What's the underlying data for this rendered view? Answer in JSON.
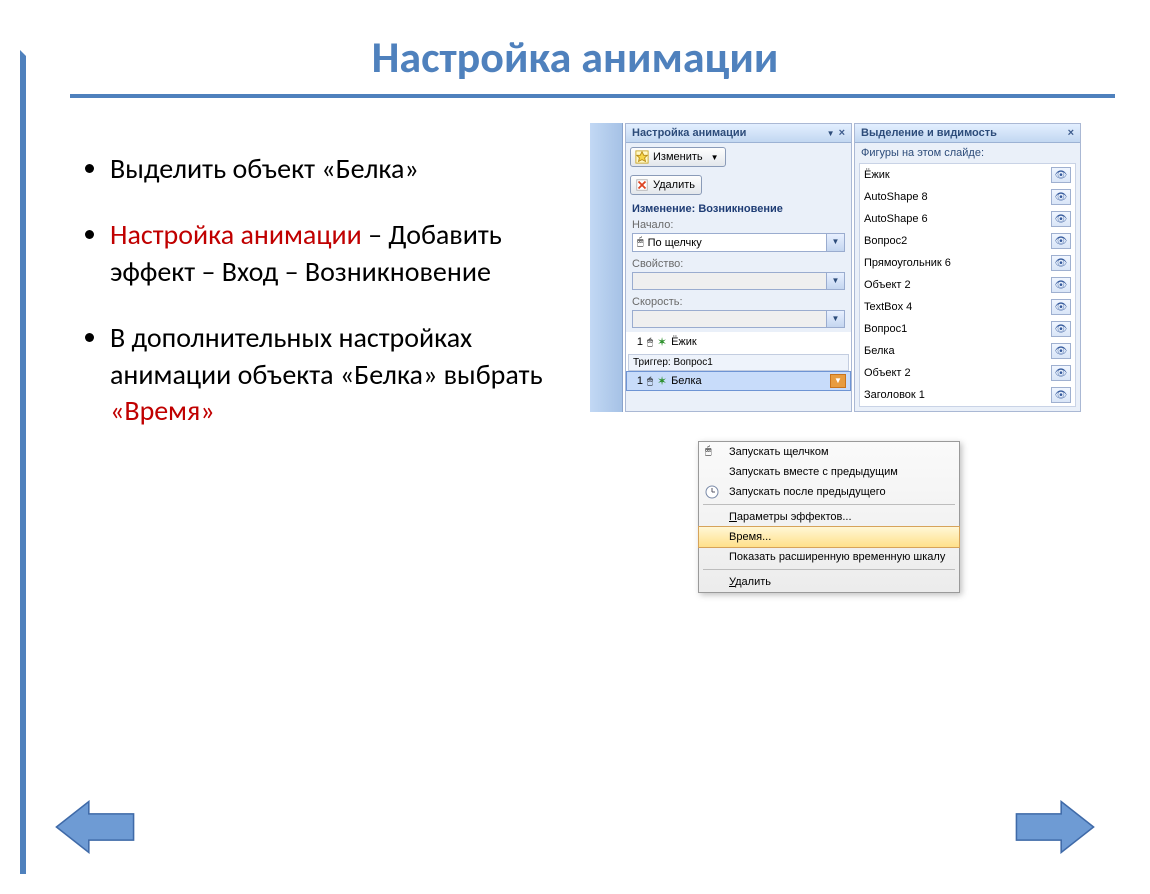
{
  "title": "Настройка анимации",
  "bullets": {
    "b1": "Выделить объект «Белка»",
    "b2a": "Настройка анимации",
    "b2b": " – Добавить эффект – Вход – Возникновение",
    "b3a": "В дополнительных настройках анимации объекта «Белка» выбрать ",
    "b3b": "«Время»"
  },
  "animPane": {
    "title": "Настройка анимации",
    "btnChange": "Изменить",
    "btnDelete": "Удалить",
    "changeLabel": "Изменение: Возникновение",
    "startLbl": "Начало:",
    "startVal": "По щелчку",
    "propLbl": "Свойство:",
    "speedLbl": "Скорость:",
    "row1": "Ёжик",
    "trigger": "Триггер: Вопрос1",
    "row2": "Белка"
  },
  "ctx": {
    "i1": "Запускать щелчком",
    "i2": "Запускать вместе с предыдущим",
    "i3": "Запускать после предыдущего",
    "i4a": "П",
    "i4b": "араметры эффектов...",
    "i5": "Время...",
    "i6": "Показать расширенную временную шкалу",
    "i7a": "У",
    "i7b": "далить"
  },
  "visPane": {
    "title": "Выделение и видимость",
    "heading": "Фигуры на этом слайде:",
    "items": [
      "Ёжик",
      "AutoShape 8",
      "AutoShape 6",
      "Вопрос2",
      "Прямоугольник 6",
      "Объект 2",
      "TextBox 4",
      "Вопрос1",
      "Белка",
      "Объект 2",
      "Заголовок 1"
    ]
  }
}
